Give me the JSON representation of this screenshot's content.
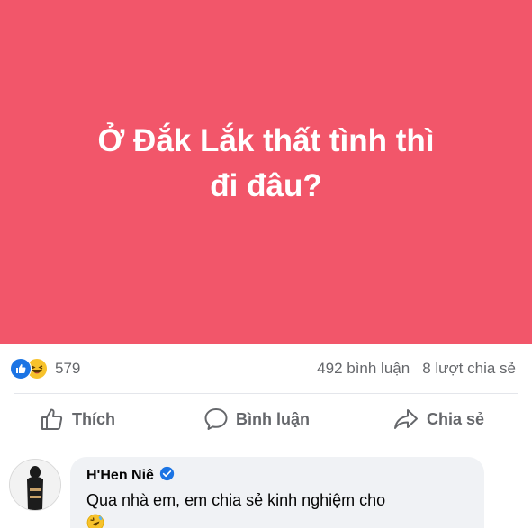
{
  "post": {
    "text_line1": "Ở Đắk Lắk thất tình thì",
    "text_line2": "đi đâu?",
    "background": "#f2566a"
  },
  "stats": {
    "reaction_icons": [
      "like-icon",
      "haha-icon"
    ],
    "reaction_count": "579",
    "comments": "492 bình luận",
    "shares": "8 lượt chia sẻ"
  },
  "actions": {
    "like_label": "Thích",
    "comment_label": "Bình luận",
    "share_label": "Chia sẻ"
  },
  "comment": {
    "author": "H'Hen Niê",
    "verified_icon": "verified-badge-icon",
    "text": "Qua nhà em, em chia sẻ kinh nghiệm cho",
    "emoji": "rolling-on-floor-laughing-emoji"
  },
  "colors": {
    "facebook_blue": "#1b74e4",
    "secondary_text": "#65676b",
    "bubble": "#f0f2f5"
  }
}
